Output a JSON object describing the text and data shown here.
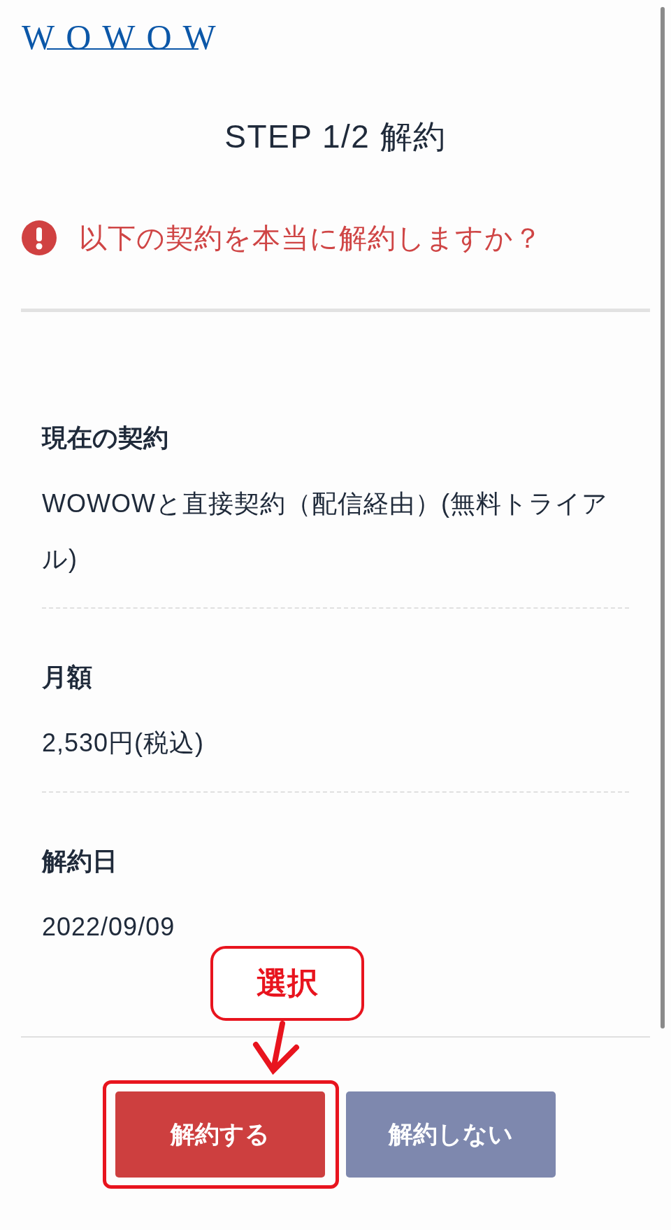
{
  "logo": {
    "text": "WOWOW"
  },
  "title": "STEP 1/2 解約",
  "alert": {
    "message": "以下の契約を本当に解約しますか？"
  },
  "details": [
    {
      "label": "現在の契約",
      "value": "WOWOWと直接契約（配信経由）(無料トライアル)"
    },
    {
      "label": "月額",
      "value": "2,530円(税込)"
    },
    {
      "label": "解約日",
      "value": "2022/09/09"
    }
  ],
  "annotation": {
    "label": "選択"
  },
  "buttons": [
    {
      "label": "解約する",
      "kind": "primary",
      "highlighted": true
    },
    {
      "label": "解約しない",
      "kind": "secondary",
      "highlighted": false
    }
  ]
}
